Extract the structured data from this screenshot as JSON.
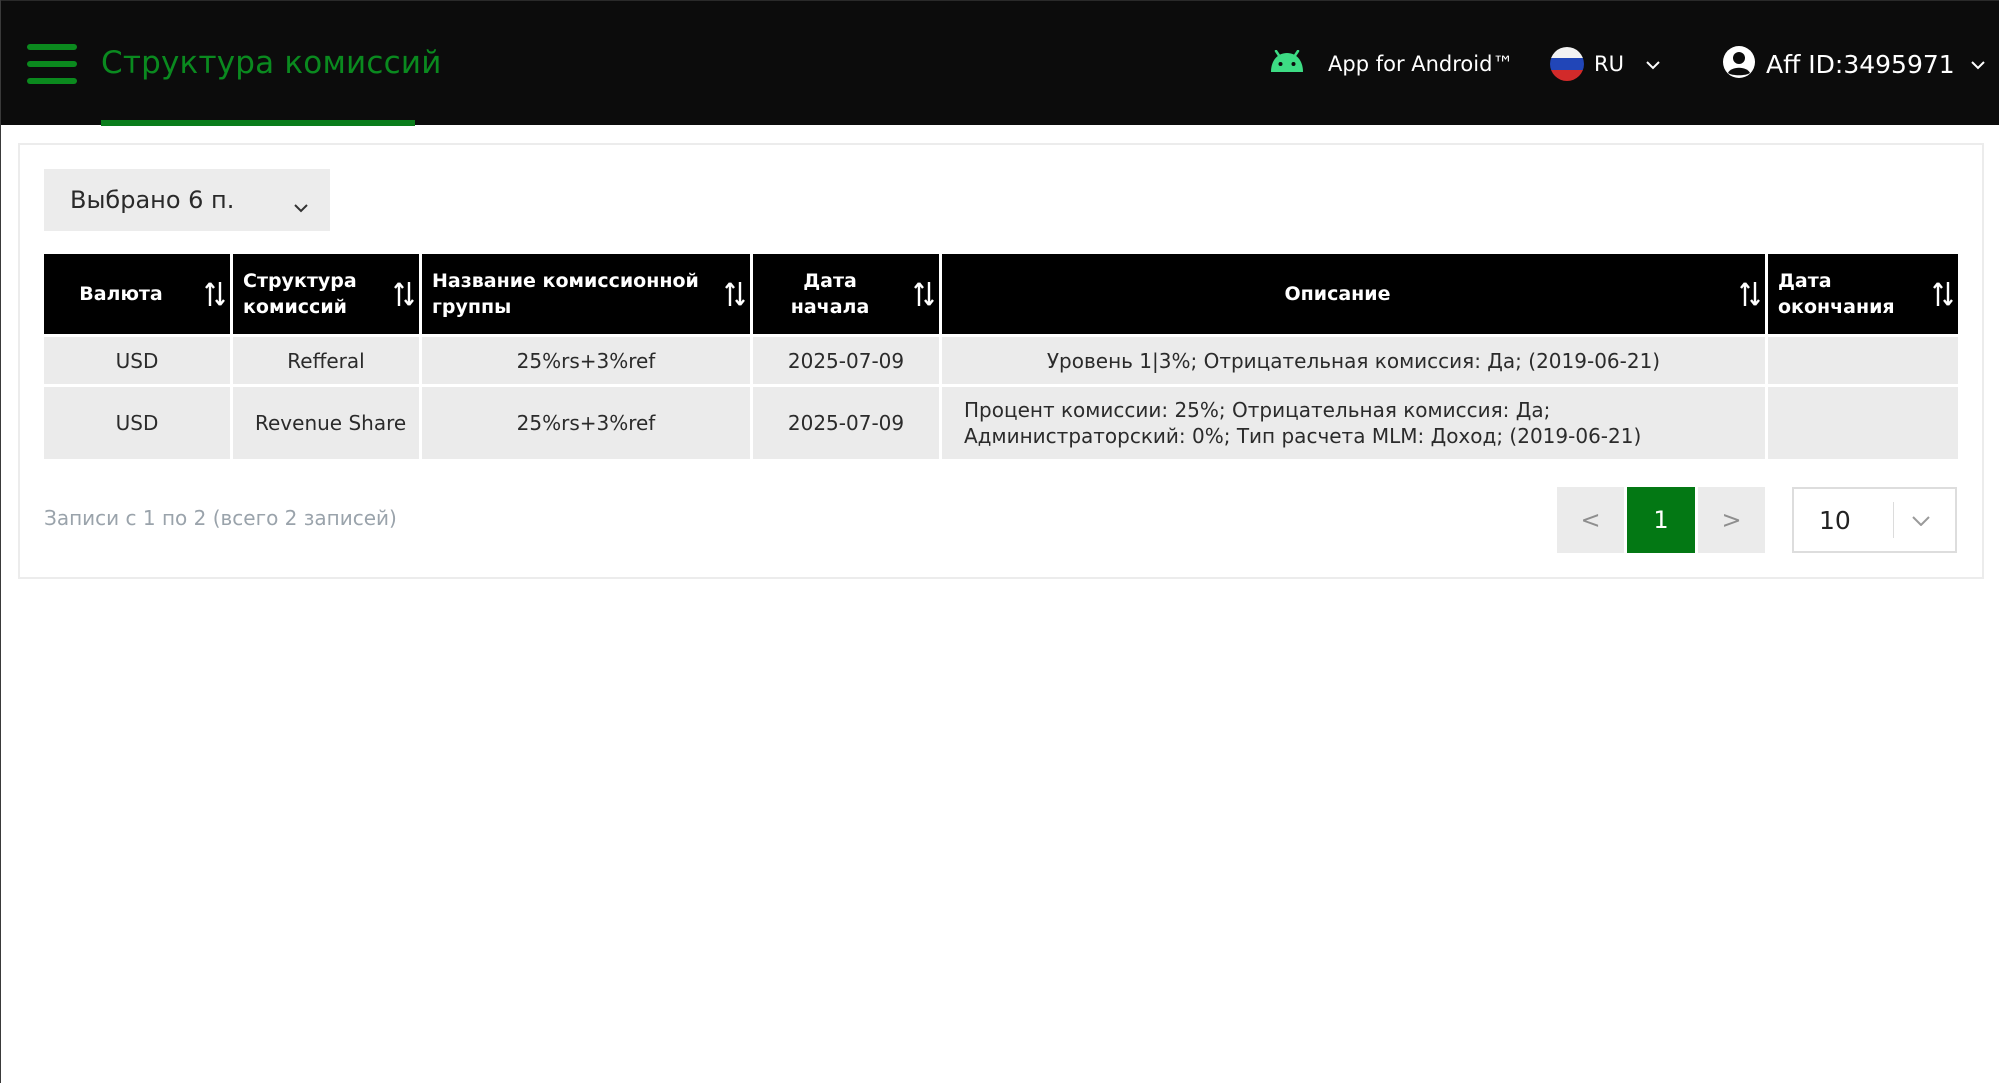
{
  "header": {
    "title": "Структура комиссий",
    "android_label": "App for Android™",
    "language_code": "RU",
    "user_label": "Aff ID:3495971"
  },
  "filter": {
    "selected_label": "Выбрано 6 п."
  },
  "table": {
    "columns": [
      "Валюта",
      "Структура комиссий",
      "Название комиссионной группы",
      "Дата начала",
      "Описание",
      "Дата окончания"
    ],
    "rows": [
      {
        "currency": "USD",
        "structure": "Refferal",
        "group_name": "25%rs+3%ref",
        "start_date": "2025-07-09",
        "description": "Уровень 1|3%; Отрицательная комиссия: Да; (2019-06-21)",
        "end_date": ""
      },
      {
        "currency": "USD",
        "structure": "Revenue Share",
        "group_name": "25%rs+3%ref",
        "start_date": "2025-07-09",
        "description": "Процент комиссии: 25%; Отрицательная комиссия: Да; Администраторский: 0%; Тип расчета MLM: Доход; (2019-06-21)",
        "end_date": ""
      }
    ]
  },
  "footer": {
    "records_info": "Записи с 1 по 2 (всего 2 записей)",
    "prev_label": "<",
    "current_page": "1",
    "next_label": ">",
    "per_page": "10"
  },
  "colors": {
    "accent": "#0a8a1f",
    "header_bg": "#0c0c0c",
    "active_page": "#037814"
  },
  "icons": [
    "menu-icon",
    "android-icon",
    "russia-flag-icon",
    "chevron-down-icon",
    "user-circle-icon",
    "sort-icon"
  ]
}
